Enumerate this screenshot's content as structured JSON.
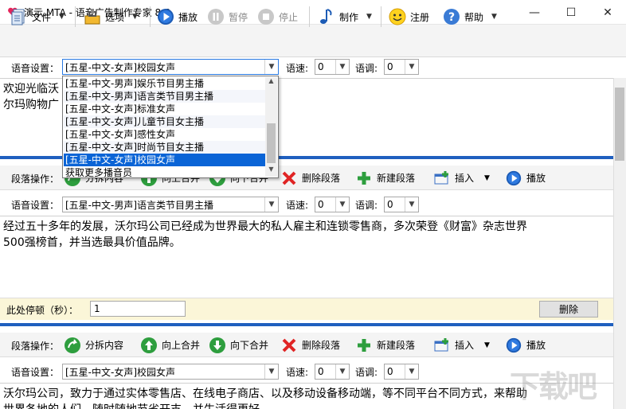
{
  "window": {
    "title": "演示.MTA - 语音广告制作专家 8.6",
    "minimize": "—",
    "maximize": "☐",
    "close": "✕"
  },
  "toolbar": {
    "file": "文件",
    "options": "选项",
    "play": "播放",
    "pause": "暂停",
    "stop": "停止",
    "make": "制作",
    "register": "注册",
    "help": "帮助"
  },
  "voice_label": "语音设置：",
  "speed_label": "语速:",
  "tone_label": "语调:",
  "para_label": "段落操作：",
  "pause_label": "此处停顿（秒）：",
  "section1": {
    "voice": "[五星-中文-女声]校园女声",
    "speed": "0",
    "tone": "0",
    "text_line1": "欢迎光临沃",
    "text_line2": "尔玛购物广"
  },
  "dropdown": {
    "items": [
      "[五星-中文-男声]娱乐节目男主播",
      "[五星-中文-男声]语言类节目男主播",
      "[五星-中文-女声]标准女声",
      "[五星-中文-女声]儿童节目女主播",
      "[五星-中文-女声]感性女声",
      "[五星-中文-女声]时尚节目女主播",
      "[五星-中文-女声]校园女声",
      "获取更多播音员"
    ],
    "selected_index": 6
  },
  "ops": {
    "split": "分拆内容",
    "merge_up": "向上合并",
    "merge_down": "向下合并",
    "delete_para": "删除段落",
    "new_para": "新建段落",
    "insert": "插入",
    "play": "播放"
  },
  "ops_partial": {
    "split": "分拆内容",
    "merge_up": "向上合并",
    "merge_down": "向下合并"
  },
  "section2": {
    "voice": "[五星-中文-男声]语言类节目男主播",
    "speed": "0",
    "tone": "0",
    "text_line1": "经过五十多年的发展，沃尔玛公司已经成为世界最大的私人雇主和连锁零售商，多次荣登《财富》杂志世界",
    "text_line2": "500强榜首，并当选最具价值品牌。"
  },
  "pause": {
    "value": "1",
    "delete": "删除"
  },
  "section3": {
    "voice": "[五星-中文-女声]校园女声",
    "speed": "0",
    "tone": "0",
    "text_line1": "沃尔玛公司，致力于通过实体零售店、在线电子商店、以及移动设备移动端，等不同平台不同方式，来帮助",
    "text_line2": "世界各地的人们，随时随地节省开支，并生活得更好。"
  },
  "watermark": "下载吧",
  "colors": {
    "accent": "#1f5fbf",
    "selection": "#0a64d6"
  }
}
